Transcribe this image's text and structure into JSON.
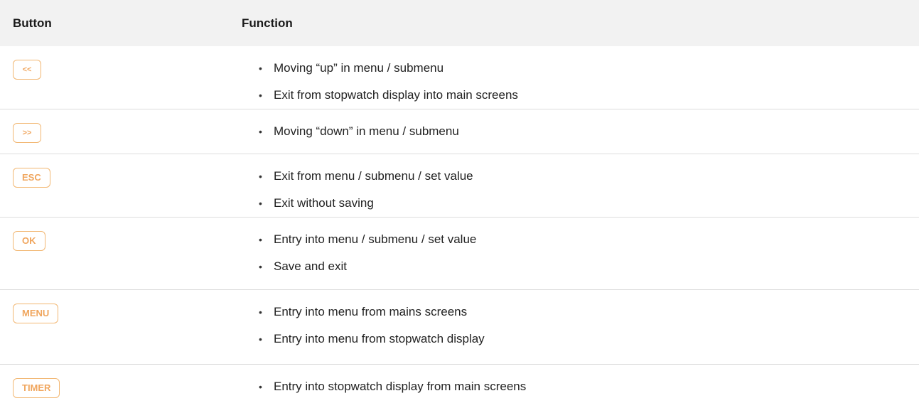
{
  "header": {
    "button": "Button",
    "function": "Function"
  },
  "rows": [
    {
      "key": "<<",
      "items": [
        "Moving “up” in menu / submenu",
        "Exit from stopwatch display into main screens"
      ]
    },
    {
      "key": ">>",
      "items": [
        "Moving “down” in menu / submenu"
      ]
    },
    {
      "key": "ESC",
      "items": [
        "Exit from menu / submenu / set value",
        "Exit without saving"
      ]
    },
    {
      "key": "OK",
      "items": [
        "Entry into menu / submenu / set value",
        "Save and exit"
      ]
    },
    {
      "key": "MENU",
      "items": [
        "Entry into menu from mains screens",
        "Entry into menu from stopwatch display"
      ]
    },
    {
      "key": "TIMER",
      "items": [
        "Entry into stopwatch display from main screens"
      ]
    }
  ],
  "bullet_char": "•",
  "colors": {
    "key_border": "#f2b772",
    "key_text": "#f0a65e",
    "header_bg": "#f2f2f2",
    "divider": "#dcdcdc"
  }
}
